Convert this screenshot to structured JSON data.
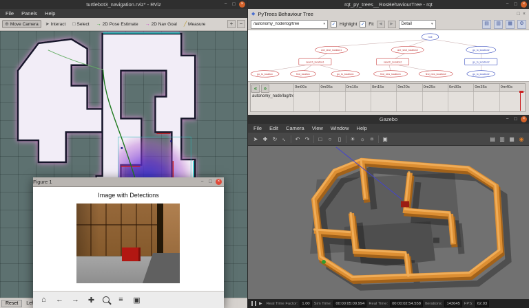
{
  "ui": {
    "check": "✓",
    "caret": "▾",
    "min": "−",
    "max": "□",
    "close": "×"
  },
  "rviz": {
    "title": "turtlebot3_navigation.rviz* - RViz",
    "menu": [
      "File",
      "Panels",
      "Help"
    ],
    "tools": [
      {
        "label": "Move Camera",
        "glyph": "⊕"
      },
      {
        "label": "Interact",
        "glyph": "➤"
      },
      {
        "label": "Select",
        "glyph": "□"
      },
      {
        "label": "2D Pose Estimate",
        "glyph": "→"
      },
      {
        "label": "2D Nav Goal",
        "glyph": "→"
      },
      {
        "label": "Measure",
        "glyph": "╱"
      }
    ],
    "add_tool": "+",
    "remove_tool": "−",
    "statusbar": {
      "reset": "Reset",
      "hint": "Left-Cl"
    }
  },
  "rqt": {
    "title": "rqt_py_trees__RosBehaviourTree - rqt",
    "panel_title": "PyTrees Behaviour Tree",
    "panel_icon": "◆",
    "topic": "/autonomy_node/log/tree",
    "highlight_label": "Highlight",
    "fit_label": "Fit",
    "detail_label": "Detail",
    "nav": {
      "prev": "◀",
      "next": "▶"
    },
    "panel_icons": [
      {
        "name": "open",
        "glyph": "▤"
      },
      {
        "name": "save",
        "glyph": "▥"
      },
      {
        "name": "image",
        "glyph": "▦"
      },
      {
        "name": "settings",
        "glyph": "⚙"
      }
    ],
    "timeline": {
      "row_label": "autonomy_node/log/tree",
      "ticks": [
        "0m00s",
        "0m05s",
        "0m10s",
        "0m15s",
        "0m20s",
        "0m25s",
        "0m30s",
        "0m35s",
        "0m40s"
      ],
      "to_start": "«",
      "to_end": "»"
    },
    "tree": {
      "nodes": [
        {
          "label": "root"
        },
        {
          "label": "one_shot_location1"
        },
        {
          "label": "one_shot_location2"
        },
        {
          "label": "go_to_location2"
        },
        {
          "label": "search_location1"
        },
        {
          "label": "search_location2"
        },
        {
          "label": "go_to_location2"
        },
        {
          "label": "go_to_location"
        },
        {
          "label": "find_location"
        },
        {
          "label": "go_to_location1"
        },
        {
          "label": "find_new_location1"
        },
        {
          "label": "find_new_location2"
        },
        {
          "label": "go_to_location2"
        }
      ]
    }
  },
  "gazebo": {
    "title": "Gazebo",
    "menu": [
      "File",
      "Edit",
      "Camera",
      "View",
      "Window",
      "Help"
    ],
    "toolbar_icons": [
      {
        "name": "select",
        "glyph": "➤"
      },
      {
        "name": "translate",
        "glyph": "✚"
      },
      {
        "name": "rotate",
        "glyph": "↻"
      },
      {
        "name": "scale",
        "glyph": "↔"
      },
      {
        "name": "undo",
        "glyph": "↶"
      },
      {
        "name": "redo",
        "glyph": "↷"
      },
      {
        "name": "box",
        "glyph": "□"
      },
      {
        "name": "sphere",
        "glyph": "○"
      },
      {
        "name": "cylinder",
        "glyph": "▯"
      },
      {
        "name": "point-light",
        "glyph": "☀"
      },
      {
        "name": "spot-light",
        "glyph": "☼"
      },
      {
        "name": "directional-light",
        "glyph": "¤"
      },
      {
        "name": "screenshot",
        "glyph": "▣"
      },
      {
        "name": "joint",
        "glyph": "▤"
      },
      {
        "name": "align",
        "glyph": "▥"
      },
      {
        "name": "snap",
        "glyph": "▦"
      },
      {
        "name": "record",
        "glyph": "◉"
      }
    ],
    "status": {
      "step_glyph": "▶",
      "rtf_label": "Real Time Factor:",
      "rtf": "1.00",
      "sim_label": "Sim Time:",
      "sim": "00:00:05:09.994",
      "real_label": "Real Time:",
      "real": "00:00:02:54.558",
      "iter_label": "Iterations:",
      "iter": "143645",
      "fps_label": "FPS:",
      "fps": "62.03"
    }
  },
  "figure": {
    "title": "Figure 1",
    "plot_title": "Image with Detections",
    "toolbar": [
      {
        "name": "home",
        "glyph": "⌂"
      },
      {
        "name": "back",
        "glyph": "←"
      },
      {
        "name": "forward",
        "glyph": "→"
      },
      {
        "name": "pan",
        "glyph": "✚"
      },
      {
        "name": "subplots",
        "glyph": "≡"
      },
      {
        "name": "save",
        "glyph": "▣"
      }
    ]
  }
}
